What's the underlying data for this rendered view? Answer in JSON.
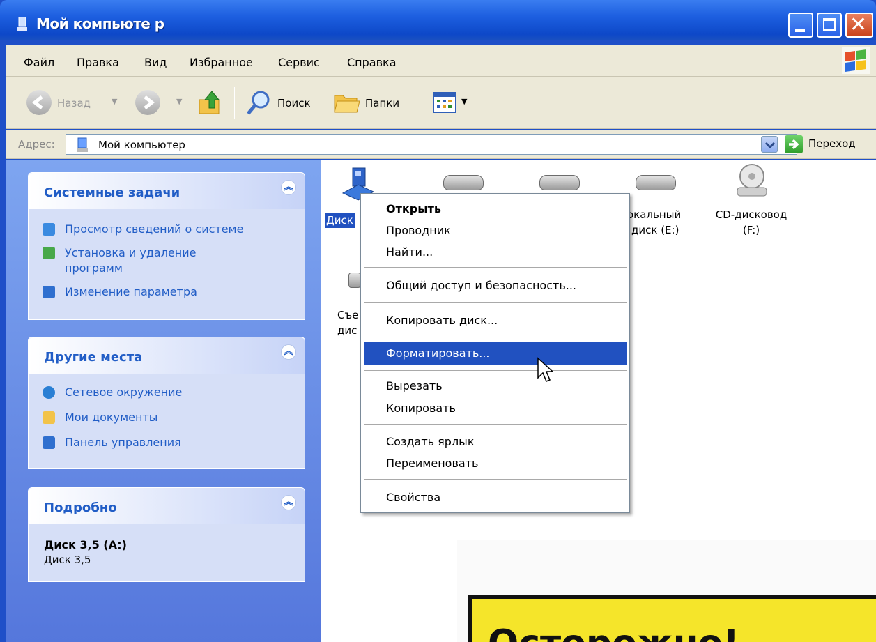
{
  "window": {
    "title": "Мой компьюте р"
  },
  "menubar": {
    "items": [
      "Файл",
      "Правка",
      "Вид",
      "Избранное",
      "Сервис",
      "Справка"
    ]
  },
  "toolbar": {
    "back_label": "Назад",
    "search_label": "Поиск",
    "folders_label": "Папки"
  },
  "address": {
    "label": "Адрес:",
    "value": "Мой компьютер",
    "go_label": "Переход"
  },
  "taskpane": {
    "system_tasks": {
      "title": "Системные задачи",
      "items": [
        "Просмотр сведений о системе",
        "Установка и удаление программ",
        "Изменение параметра"
      ]
    },
    "other_places": {
      "title": "Другие места",
      "items": [
        "Сетевое окружение",
        "Мои документы",
        "Панель управления"
      ]
    },
    "details": {
      "title": "Подробно",
      "name": "Диск 3,5 (A:)",
      "type": "Диск 3,5"
    }
  },
  "drives": {
    "floppy_label": "Диск",
    "local_e_line1": "окальный",
    "local_e_line2": "диск (E:)",
    "cd_line1": "CD-дисковод",
    "cd_line2": "(F:)",
    "removable_line1": "Съе",
    "removable_line2": "дис"
  },
  "context_menu": {
    "items": [
      "Открыть",
      "Проводник",
      "Найти...",
      "Общий доступ и безопасность...",
      "Копировать диск...",
      "Форматировать...",
      "Вырезать",
      "Копировать",
      "Создать ярлык",
      "Переименовать",
      "Свойства"
    ],
    "highlighted": "Форматировать..."
  },
  "overlay": {
    "caution_text": "Осторожно!"
  },
  "colors": {
    "titlebar": "#1d5fe0",
    "menu_highlight": "#2151c0",
    "taskpane_link": "#215dc6",
    "caution_yellow": "#f5e52a"
  }
}
